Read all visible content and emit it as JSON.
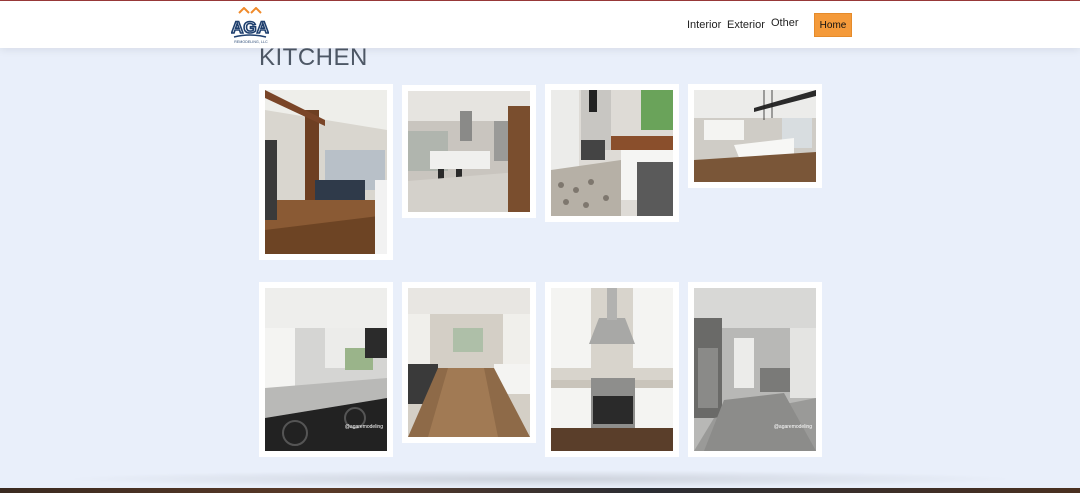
{
  "header": {
    "logo_text": "AGA",
    "logo_subtext": "REMODELING, LLC",
    "nav": [
      {
        "label": "Interior"
      },
      {
        "label": "Exterior"
      },
      {
        "label": "Other"
      },
      {
        "label": "Home"
      }
    ],
    "accent_color": "#f49a3a"
  },
  "main": {
    "title": "KITCHEN",
    "photos": [
      {
        "alt": "Kitchen with wood beams and island"
      },
      {
        "alt": "Kitchen island with stools and range hood"
      },
      {
        "alt": "Farmhouse sink and butcher block counter"
      },
      {
        "alt": "Open kitchen with white island and pendants"
      },
      {
        "alt": "Long white kitchen with gas cooktop",
        "watermark": "@agaremodeling"
      },
      {
        "alt": "Kitchen hallway with wood floors"
      },
      {
        "alt": "Range with stainless hood and white cabinets"
      },
      {
        "alt": "Gray kitchen with stainless refrigerator",
        "watermark": "@agaremodeling"
      }
    ]
  }
}
